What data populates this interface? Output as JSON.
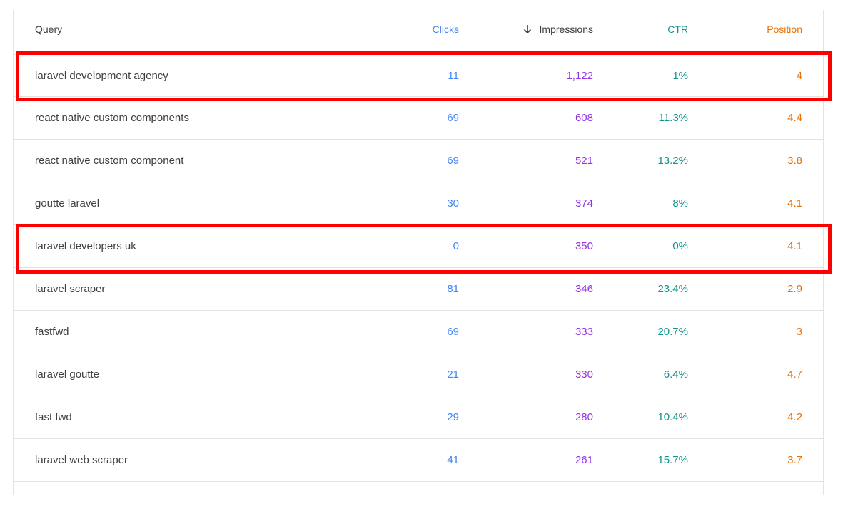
{
  "table": {
    "headers": {
      "query": "Query",
      "clicks": "Clicks",
      "impressions": "Impressions",
      "ctr": "CTR",
      "position": "Position"
    },
    "sort_icon": "arrow-down-icon",
    "rows": [
      {
        "query": "laravel development agency",
        "clicks": "11",
        "impressions": "1,122",
        "ctr": "1%",
        "position": "4"
      },
      {
        "query": "react native custom components",
        "clicks": "69",
        "impressions": "608",
        "ctr": "11.3%",
        "position": "4.4"
      },
      {
        "query": "react native custom component",
        "clicks": "69",
        "impressions": "521",
        "ctr": "13.2%",
        "position": "3.8"
      },
      {
        "query": "goutte laravel",
        "clicks": "30",
        "impressions": "374",
        "ctr": "8%",
        "position": "4.1"
      },
      {
        "query": "laravel developers uk",
        "clicks": "0",
        "impressions": "350",
        "ctr": "0%",
        "position": "4.1"
      },
      {
        "query": "laravel scraper",
        "clicks": "81",
        "impressions": "346",
        "ctr": "23.4%",
        "position": "2.9"
      },
      {
        "query": "fastfwd",
        "clicks": "69",
        "impressions": "333",
        "ctr": "20.7%",
        "position": "3"
      },
      {
        "query": "laravel goutte",
        "clicks": "21",
        "impressions": "330",
        "ctr": "6.4%",
        "position": "4.7"
      },
      {
        "query": "fast fwd",
        "clicks": "29",
        "impressions": "280",
        "ctr": "10.4%",
        "position": "4.2"
      },
      {
        "query": "laravel web scraper",
        "clicks": "41",
        "impressions": "261",
        "ctr": "15.7%",
        "position": "3.7"
      }
    ]
  },
  "colors": {
    "clicks": "#4285f4",
    "impressions": "#9334e6",
    "ctr": "#12948a",
    "position": "#e8710a",
    "highlight": "#ff0000"
  }
}
